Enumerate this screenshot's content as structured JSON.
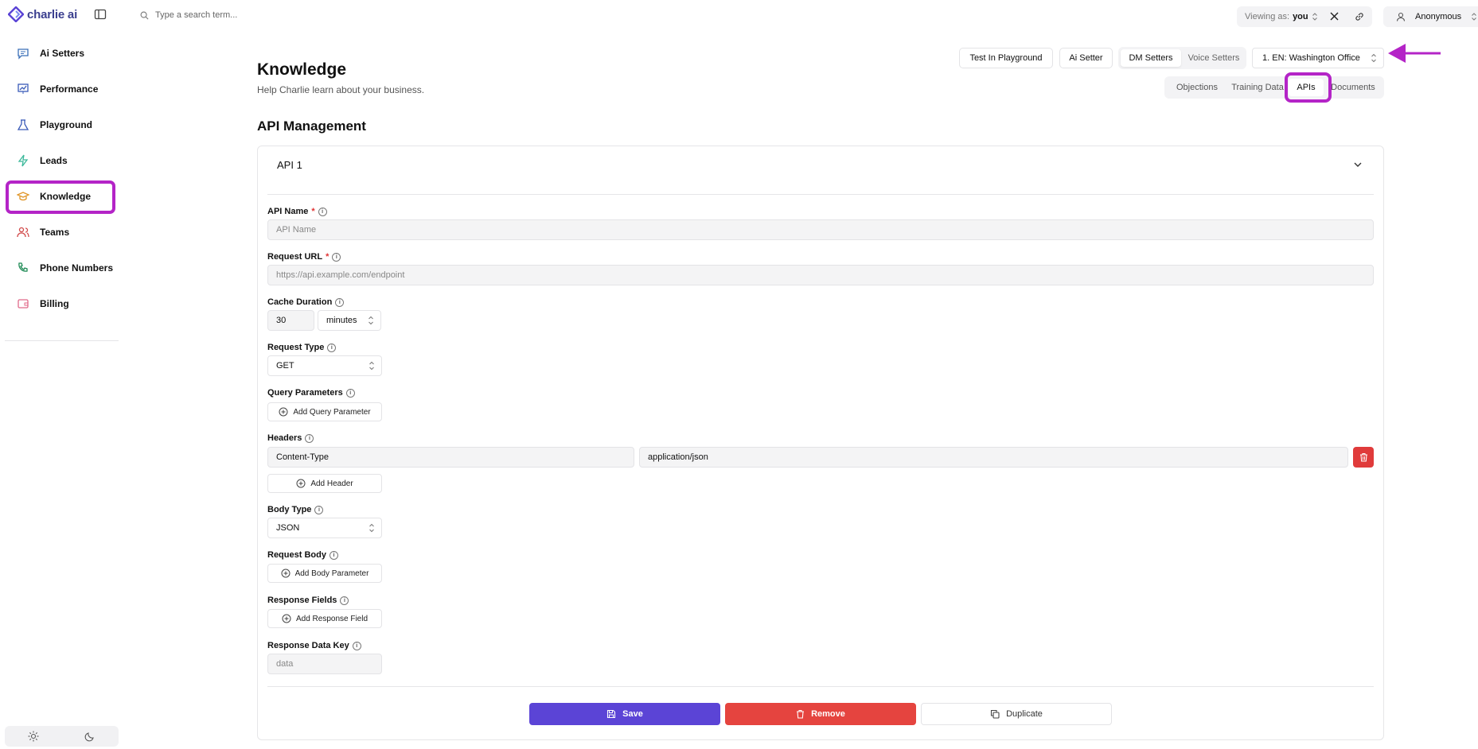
{
  "app": {
    "logo_text": "charlie ai"
  },
  "sidebar": {
    "items": [
      {
        "label": "Ai Setters",
        "icon": "chat-bubble-icon"
      },
      {
        "label": "Performance",
        "icon": "chart-icon"
      },
      {
        "label": "Playground",
        "icon": "flask-icon"
      },
      {
        "label": "Leads",
        "icon": "lightning-icon"
      },
      {
        "label": "Knowledge",
        "icon": "graduation-cap-icon",
        "active": true
      },
      {
        "label": "Teams",
        "icon": "users-icon"
      },
      {
        "label": "Phone Numbers",
        "icon": "phone-icon"
      },
      {
        "label": "Billing",
        "icon": "wallet-icon"
      }
    ]
  },
  "topbar": {
    "search_placeholder": "Type a search term...",
    "viewing_prefix": "Viewing as:",
    "viewing_value": "you",
    "user_name": "Anonymous"
  },
  "header": {
    "title": "Knowledge",
    "subtitle": "Help Charlie learn about your business.",
    "test_button": "Test In Playground",
    "ai_setter_button": "Ai Setter",
    "segment": [
      "DM Setters",
      "Voice Setters"
    ],
    "location_select": "1. EN: Washington Office",
    "tabs": [
      "Objections",
      "Training Data",
      "APIs",
      "Documents"
    ],
    "active_tab": "APIs"
  },
  "section": {
    "title": "API Management"
  },
  "api": {
    "title": "API 1",
    "name_label": "API Name",
    "name_placeholder": "API Name",
    "url_label": "Request URL",
    "url_placeholder": "https://api.example.com/endpoint",
    "cache_label": "Cache Duration",
    "cache_value": "30",
    "cache_unit": "minutes",
    "request_type_label": "Request Type",
    "request_type": "GET",
    "query_label": "Query Parameters",
    "add_query": "Add Query Parameter",
    "headers_label": "Headers",
    "header_key": "Content-Type",
    "header_value": "application/json",
    "add_header": "Add Header",
    "body_type_label": "Body Type",
    "body_type": "JSON",
    "request_body_label": "Request Body",
    "add_body": "Add Body Parameter",
    "response_fields_label": "Response Fields",
    "add_response": "Add Response Field",
    "response_key_label": "Response Data Key",
    "response_key_placeholder": "data"
  },
  "actions": {
    "save": "Save",
    "remove": "Remove",
    "duplicate": "Duplicate"
  },
  "colors": {
    "accent": "#5b44d6",
    "danger": "#e5443f",
    "highlight": "#b424c7"
  }
}
